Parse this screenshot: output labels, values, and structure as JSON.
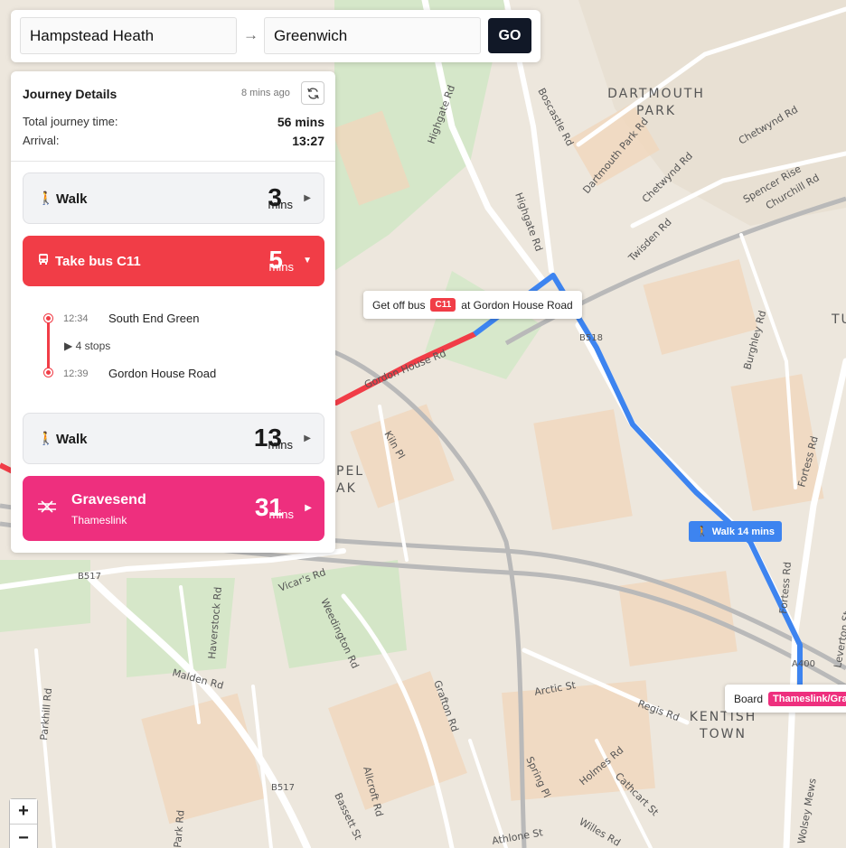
{
  "search": {
    "from_value": "Hampstead Heath",
    "to_value": "Greenwich",
    "go_label": "GO",
    "arrow_icon": "→"
  },
  "journey": {
    "title": "Journey Details",
    "updated": "8 mins ago",
    "total_time_label": "Total journey time:",
    "total_time_value": "56 mins",
    "arrival_label": "Arrival:",
    "arrival_value": "13:27",
    "steps": [
      {
        "type": "walk",
        "label": "Walk",
        "duration": "3",
        "unit": "mins",
        "arrow": "▶",
        "icon": "walk-icon"
      },
      {
        "type": "bus",
        "label": "Take bus C11",
        "duration": "5",
        "unit": "mins",
        "arrow": "▼",
        "icon": "bus-icon",
        "stops": [
          {
            "time": "12:34",
            "name": "South End Green"
          },
          {
            "time": "12:39",
            "name": "Gordon House Road"
          }
        ],
        "stops_toggle": "▶ 4 stops"
      },
      {
        "type": "walk",
        "label": "Walk",
        "duration": "13",
        "unit": "mins",
        "arrow": "▶",
        "icon": "walk-icon"
      },
      {
        "type": "train",
        "label": "Gravesend",
        "sublabel": "Thameslink",
        "duration": "31",
        "unit": "mins",
        "arrow": "▶",
        "icon": "train-icon"
      }
    ]
  },
  "map": {
    "popup_bus": {
      "prefix": "Get off bus",
      "badge": "C11",
      "suffix": "at Gordon House Road"
    },
    "walk_tag": "Walk 14 mins",
    "popup_board": {
      "prefix": "Board",
      "badge": "Thameslink/Gra"
    },
    "zoom_in": "+",
    "zoom_out": "−",
    "route_colors": {
      "bus": "#f13d47",
      "walk": "#3d84f0",
      "train": "#ee2f7e"
    },
    "area_labels": [
      "DARTMOUTH",
      "PARK",
      "KENTISH",
      "TOWN",
      "PEL",
      "AK",
      "TU"
    ],
    "road_labels": [
      "Highgate Rd",
      "Boscastle Rd",
      "Dartmouth Park Rd",
      "Chetwynd Rd",
      "Twisden Rd",
      "Spencer Rise",
      "Churchill Rd",
      "Chetwynd Rd",
      "Burghley Rd",
      "Fortess Rd",
      "Fortess Rd",
      "Leverton St",
      "Kiln Pl",
      "Vicar's Rd",
      "Haverstock Rd",
      "Weedington Rd",
      "Malden Rd",
      "Parkhill Rd",
      "Grafton Rd",
      "Arctic St",
      "Regis Rd",
      "Holmes Rd",
      "Cathcart St",
      "Spring Pl",
      "Willes Rd",
      "Allcroft Rd",
      "Bassett St",
      "Athlone St",
      "Wolsey Mews",
      "B518",
      "B517",
      "B517",
      "A400",
      "Gordon House Rd",
      "Highgate Rd",
      "Park Rd"
    ]
  }
}
